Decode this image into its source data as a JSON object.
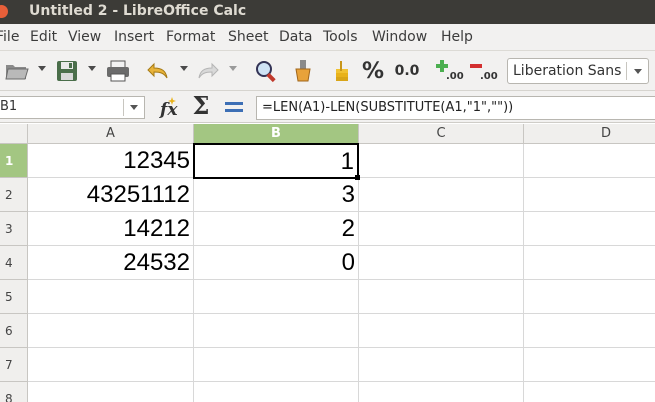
{
  "window": {
    "title": "Untitled 2 - LibreOffice Calc"
  },
  "menu": [
    "File",
    "Edit",
    "View",
    "Insert",
    "Format",
    "Sheet",
    "Data",
    "Tools",
    "Window",
    "Help"
  ],
  "toolbar": {
    "icons": [
      "open-folder-icon",
      "save-icon",
      "print-icon",
      "undo-icon",
      "redo-icon",
      "find-replace-icon",
      "clone-formatting-icon",
      "currency-icon",
      "percent-icon",
      "number-format-icon",
      "add-decimal-icon",
      "delete-decimal-icon"
    ],
    "percent_label": "%",
    "number_format_label": "0.0",
    "add_decimal_label": ".00",
    "delete_decimal_label": ".00",
    "font_name": "Liberation Sans"
  },
  "formula_bar": {
    "name_box": "B1",
    "formula": "=LEN(A1)-LEN(SUBSTITUTE(A1,\"1\",\"\"))"
  },
  "sheet": {
    "columns": [
      "A",
      "B",
      "C",
      "D"
    ],
    "active_column": "B",
    "rows": [
      {
        "num": "1",
        "A": "12345",
        "B": "1"
      },
      {
        "num": "2",
        "A": "43251112",
        "B": "3"
      },
      {
        "num": "3",
        "A": "14212",
        "B": "2"
      },
      {
        "num": "4",
        "A": "24532",
        "B": "0"
      },
      {
        "num": "5",
        "A": "",
        "B": ""
      },
      {
        "num": "6",
        "A": "",
        "B": ""
      },
      {
        "num": "7",
        "A": "",
        "B": ""
      },
      {
        "num": "8",
        "A": "",
        "B": ""
      }
    ],
    "active_row": "1"
  },
  "colors": {
    "active_header": "#a3c682",
    "titlebar": "#3c3b37",
    "close_button": "#e85f39"
  }
}
